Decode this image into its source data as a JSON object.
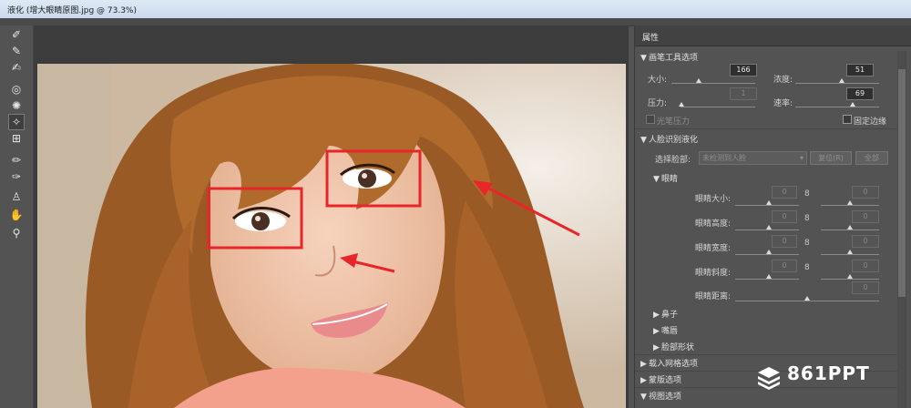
{
  "window": {
    "title": "液化 (增大眼睛原图.jpg @ 73.3%)"
  },
  "tools": [
    {
      "name": "forward-warp-tool-icon",
      "glyph": "✐"
    },
    {
      "name": "reconstruct-tool-icon",
      "glyph": "✎"
    },
    {
      "name": "smooth-tool-icon",
      "glyph": "✍"
    },
    {
      "name": "twirl-tool-icon",
      "glyph": "◎"
    },
    {
      "name": "pucker-tool-icon",
      "glyph": "✺"
    },
    {
      "name": "bloat-tool-icon",
      "glyph": "✧"
    },
    {
      "name": "push-left-tool-icon",
      "glyph": "⊞"
    },
    {
      "name": "freeze-mask-tool-icon",
      "glyph": "✏"
    },
    {
      "name": "thaw-mask-tool-icon",
      "glyph": "✑"
    },
    {
      "name": "face-tool-icon",
      "glyph": "♙"
    },
    {
      "name": "hand-tool-icon",
      "glyph": "✋"
    },
    {
      "name": "zoom-tool-icon",
      "glyph": "⚲"
    }
  ],
  "panel": {
    "title": "属性",
    "brush_section": "画笔工具选项",
    "size_label": "大小:",
    "size_value": "166",
    "density_label": "浓度:",
    "density_value": "51",
    "pressure_label": "压力:",
    "pressure_value": "1",
    "rate_label": "速率:",
    "rate_value": "69",
    "stylus_label": "光笔压力",
    "pin_edges_label": "固定边缘",
    "face_section": "人脸识别液化",
    "select_face_label": "选择脸部:",
    "select_face_value": "未检测到人脸",
    "reset_label": "复位(R)",
    "all_label": "全部",
    "eyes_label": "眼睛",
    "eye_size_label": "眼睛大小:",
    "eye_height_label": "眼睛高度:",
    "eye_width_label": "眼睛宽度:",
    "eye_tilt_label": "眼睛斜度:",
    "eye_distance_label": "眼睛距离:",
    "eye_zero": "0",
    "nose_label": "鼻子",
    "mouth_label": "嘴唇",
    "face_shape_label": "脸部形状",
    "load_mesh_section": "载入网格选项",
    "mask_section": "蒙版选项",
    "view_section": "视图选项"
  },
  "watermark": "861PPT",
  "colors": {
    "annotation_red": "#e8262a",
    "panel_bg": "#535353",
    "titlebar": "#c9d9ec"
  }
}
